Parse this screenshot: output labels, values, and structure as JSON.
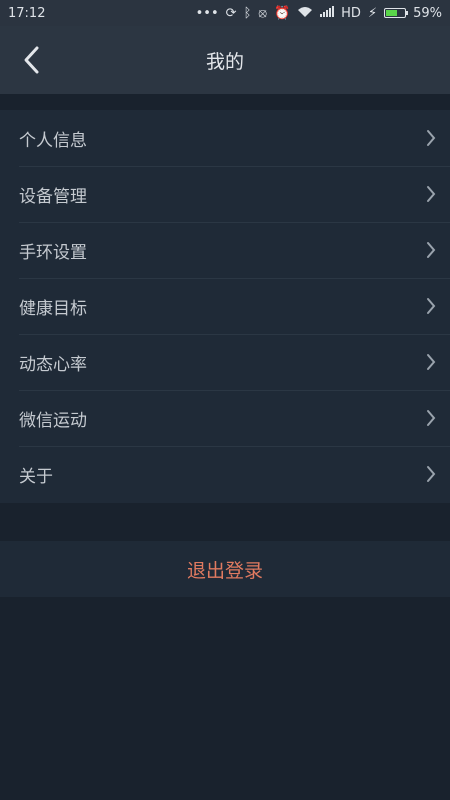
{
  "status_bar": {
    "time": "17:12",
    "network": "HD",
    "battery": "59%",
    "battery_level": 0.59,
    "battery_color": "#5ad54a"
  },
  "header": {
    "title": "我的"
  },
  "menu": {
    "items": [
      {
        "label": "个人信息"
      },
      {
        "label": "设备管理"
      },
      {
        "label": "手环设置"
      },
      {
        "label": "健康目标"
      },
      {
        "label": "动态心率"
      },
      {
        "label": "微信运动"
      },
      {
        "label": "关于"
      }
    ]
  },
  "logout": {
    "label": "退出登录",
    "color": "#e07a60"
  }
}
